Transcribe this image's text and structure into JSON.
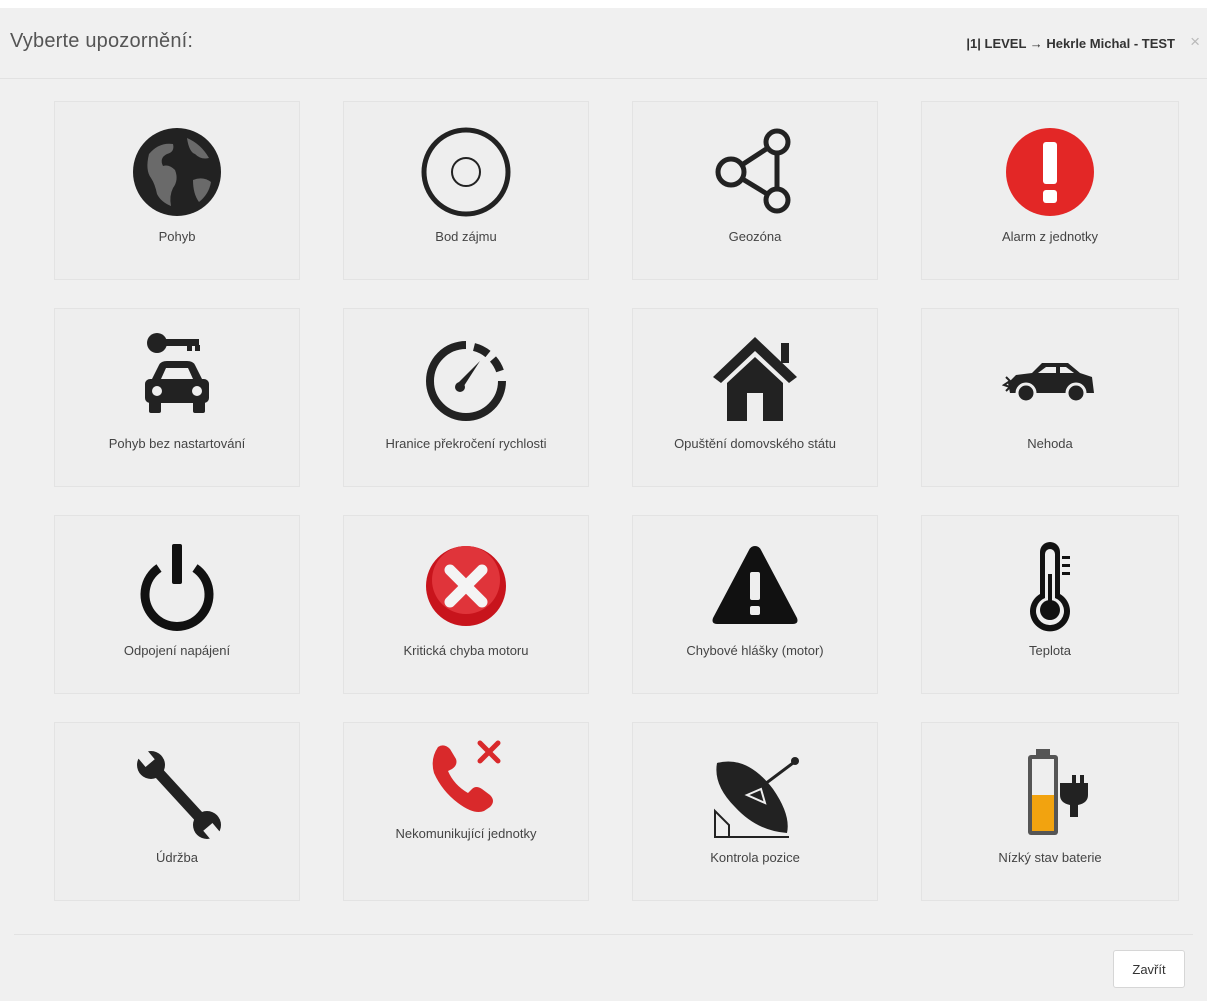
{
  "header": {
    "title": "Vyberte upozornění:",
    "context": "|1| LEVEL → Hekrle Michal - TEST",
    "close_glyph": "×"
  },
  "tiles": [
    {
      "label": "Pohyb",
      "icon": "globe-icon"
    },
    {
      "label": "Bod zájmu",
      "icon": "target-circle-icon"
    },
    {
      "label": "Geozóna",
      "icon": "share-nodes-icon"
    },
    {
      "label": "Alarm z jednotky",
      "icon": "alarm-exclamation-icon",
      "color": "#e32726"
    },
    {
      "label": "Pohyb bez nastartování",
      "icon": "key-car-icon"
    },
    {
      "label": "Hranice překročení rychlosti",
      "icon": "speedometer-icon"
    },
    {
      "label": "Opuštění domovského státu",
      "icon": "house-icon"
    },
    {
      "label": "Nehoda",
      "icon": "crashed-car-icon"
    },
    {
      "label": "Odpojení napájení",
      "icon": "power-icon"
    },
    {
      "label": "Kritická chyba motoru",
      "icon": "error-x-icon",
      "color": "#c8141c"
    },
    {
      "label": "Chybové hlášky (motor)",
      "icon": "warning-triangle-icon"
    },
    {
      "label": "Teplota",
      "icon": "thermometer-icon"
    },
    {
      "label": "Údržba",
      "icon": "wrench-icon"
    },
    {
      "label": "Nekomunikující jednotky",
      "icon": "missed-call-icon",
      "color": "#d9292b"
    },
    {
      "label": "Kontrola pozice",
      "icon": "satellite-dish-icon"
    },
    {
      "label": "Nízký stav baterie",
      "icon": "low-battery-icon",
      "color": "#f2a30f"
    }
  ],
  "footer": {
    "close_label": "Zavřít"
  }
}
